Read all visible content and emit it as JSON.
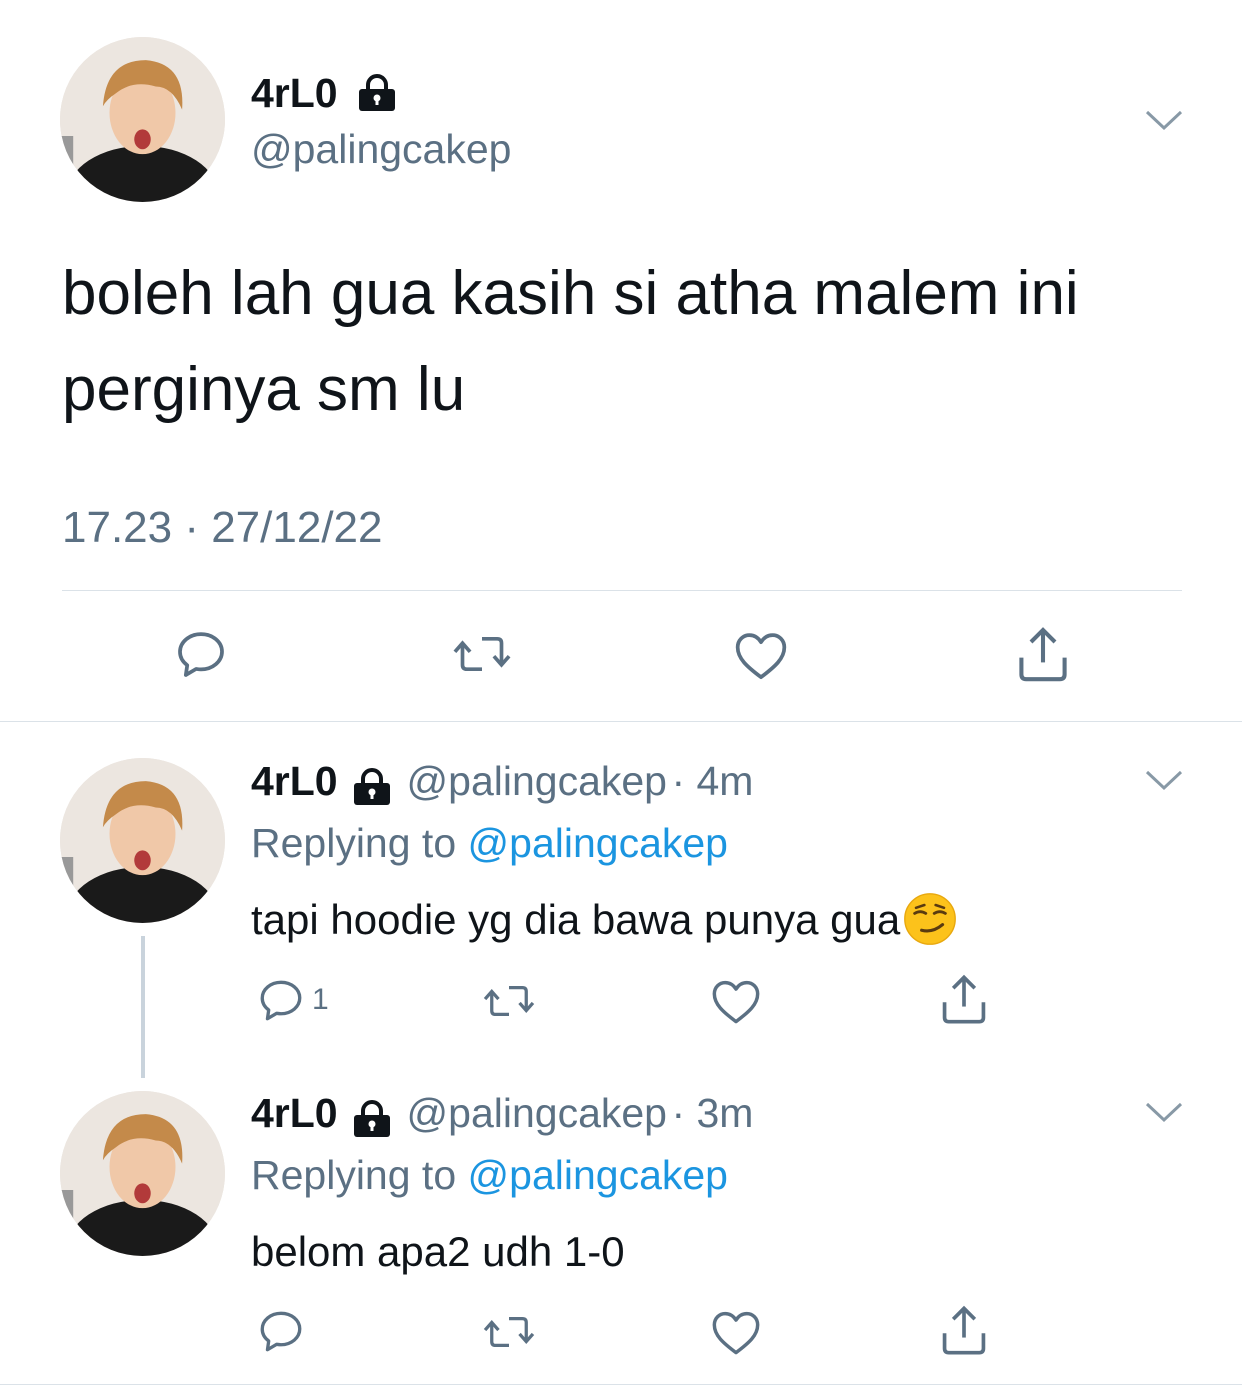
{
  "main_tweet": {
    "display_name": "4rL0",
    "handle": "@palingcakep",
    "text_line1": "boleh lah gua kasih si atha malem ini",
    "text_line2": "perginya sm lu",
    "timestamp": "17.23 · 27/12/22",
    "icons": [
      "lock-icon",
      "chevron-down-icon",
      "reply-icon",
      "retweet-icon",
      "like-icon",
      "share-icon"
    ]
  },
  "replies": [
    {
      "display_name": "4rL0",
      "handle": "@palingcakep",
      "time": "· 4m",
      "replying_prefix": "Replying to ",
      "replying_to": "@palingcakep",
      "text": "tapi hoodie yg dia bawa punya gua",
      "emoji": "smirking-face-emoji",
      "reply_count": "1"
    },
    {
      "display_name": "4rL0",
      "handle": "@palingcakep",
      "time": "· 3m",
      "replying_prefix": "Replying to ",
      "replying_to": "@palingcakep",
      "text": "belom apa2 udh 1-0",
      "reply_count": ""
    }
  ],
  "colors": {
    "text": "#0f1419",
    "secondary": "#5b7083",
    "link": "#1b95e0",
    "divider": "#dbe2e8"
  }
}
